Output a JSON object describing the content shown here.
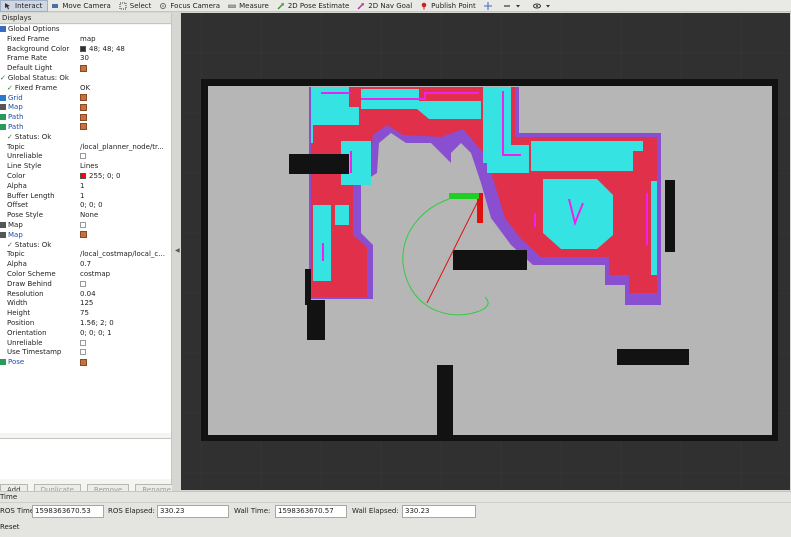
{
  "toolbar": {
    "tools": [
      {
        "name": "interact",
        "label": "Interact",
        "icon": "interact-icon"
      },
      {
        "name": "move-camera",
        "label": "Move Camera",
        "icon": "move-camera-icon"
      },
      {
        "name": "select",
        "label": "Select",
        "icon": "select-icon"
      },
      {
        "name": "focus-camera",
        "label": "Focus Camera",
        "icon": "focus-camera-icon"
      },
      {
        "name": "measure",
        "label": "Measure",
        "icon": "measure-icon"
      },
      {
        "name": "2d-pose-estimate",
        "label": "2D Pose Estimate",
        "icon": "pose-estimate-icon"
      },
      {
        "name": "2d-nav-goal",
        "label": "2D Nav Goal",
        "icon": "nav-goal-icon"
      },
      {
        "name": "publish-point",
        "label": "Publish Point",
        "icon": "publish-point-icon"
      }
    ]
  },
  "displays": {
    "title": "Displays",
    "rows": [
      {
        "indent": 0,
        "key": "Global Options",
        "value": "",
        "icon": "globe-icon"
      },
      {
        "indent": 1,
        "key": "Fixed Frame",
        "value": "map"
      },
      {
        "indent": 1,
        "key": "Background Color",
        "value": "48; 48; 48",
        "swatch": "#303030"
      },
      {
        "indent": 1,
        "key": "Frame Rate",
        "value": "30"
      },
      {
        "indent": 1,
        "key": "Default Light",
        "value": "",
        "checked": true
      },
      {
        "indent": 0,
        "key": "Global Status: Ok",
        "value": "",
        "status": true
      },
      {
        "indent": 1,
        "key": "Fixed Frame",
        "value": "OK",
        "status": true
      },
      {
        "indent": 0,
        "key": "Grid",
        "value": "",
        "checked": true,
        "blue": true,
        "icon": "grid-icon"
      },
      {
        "indent": 0,
        "key": "Map",
        "value": "",
        "checked": true,
        "blue": true,
        "icon": "map-icon"
      },
      {
        "indent": 0,
        "key": "Path",
        "value": "",
        "checked": true,
        "blue": true,
        "icon": "path-icon"
      },
      {
        "indent": 0,
        "key": "Path",
        "value": "",
        "checked": true,
        "blue": true,
        "icon": "path-icon"
      },
      {
        "indent": 1,
        "key": "Status: Ok",
        "value": "",
        "status": true
      },
      {
        "indent": 1,
        "key": "Topic",
        "value": "/local_planner_node/tr..."
      },
      {
        "indent": 1,
        "key": "Unreliable",
        "value": "",
        "unchecked": true
      },
      {
        "indent": 1,
        "key": "Line Style",
        "value": "Lines"
      },
      {
        "indent": 1,
        "key": "Color",
        "value": "255; 0; 0",
        "swatch": "#ff0000"
      },
      {
        "indent": 1,
        "key": "Alpha",
        "value": "1"
      },
      {
        "indent": 1,
        "key": "Buffer Length",
        "value": "1"
      },
      {
        "indent": 1,
        "key": "Offset",
        "value": "0; 0; 0"
      },
      {
        "indent": 1,
        "key": "Pose Style",
        "value": "None"
      },
      {
        "indent": 0,
        "key": "Map",
        "value": "",
        "unchecked": true,
        "icon": "map-icon"
      },
      {
        "indent": 0,
        "key": "Map",
        "value": "",
        "checked": true,
        "blue": true,
        "icon": "map-icon"
      },
      {
        "indent": 1,
        "key": "Status: Ok",
        "value": "",
        "status": true
      },
      {
        "indent": 1,
        "key": "Topic",
        "value": "/local_costmap/local_c..."
      },
      {
        "indent": 1,
        "key": "Alpha",
        "value": "0.7"
      },
      {
        "indent": 1,
        "key": "Color Scheme",
        "value": "costmap"
      },
      {
        "indent": 1,
        "key": "Draw Behind",
        "value": "",
        "unchecked": true
      },
      {
        "indent": 1,
        "key": "Resolution",
        "value": "0.04"
      },
      {
        "indent": 1,
        "key": "Width",
        "value": "125"
      },
      {
        "indent": 1,
        "key": "Height",
        "value": "75"
      },
      {
        "indent": 1,
        "key": "Position",
        "value": "1.56; 2; 0"
      },
      {
        "indent": 1,
        "key": "Orientation",
        "value": "0; 0; 0; 1"
      },
      {
        "indent": 1,
        "key": "Unreliable",
        "value": "",
        "unchecked": true
      },
      {
        "indent": 1,
        "key": "Use Timestamp",
        "value": "",
        "unchecked": true
      },
      {
        "indent": 0,
        "key": "Pose",
        "value": "",
        "checked": true,
        "blue": true,
        "icon": "pose-icon"
      }
    ],
    "buttons": {
      "add": "Add",
      "duplicate": "Duplicate",
      "remove": "Remove",
      "rename": "Rename"
    }
  },
  "time": {
    "title": "Time",
    "ros_time_label": "ROS Time:",
    "ros_time": "1598363670.53",
    "ros_elapsed_label": "ROS Elapsed:",
    "ros_elapsed": "330.23",
    "wall_time_label": "Wall Time:",
    "wall_time": "1598363670.57",
    "wall_elapsed_label": "Wall Elapsed:",
    "wall_elapsed": "330.23",
    "reset_label": "Reset"
  },
  "colors": {
    "background": "#303030",
    "map_free": "#b6b6b6",
    "map_wall": "#101010",
    "cost_cyan": "#35e3e3",
    "cost_magenta": "#ee22ee",
    "cost_red": "#e0304a",
    "cost_purple": "#8a4fd0",
    "path_green": "#2ecc40"
  }
}
